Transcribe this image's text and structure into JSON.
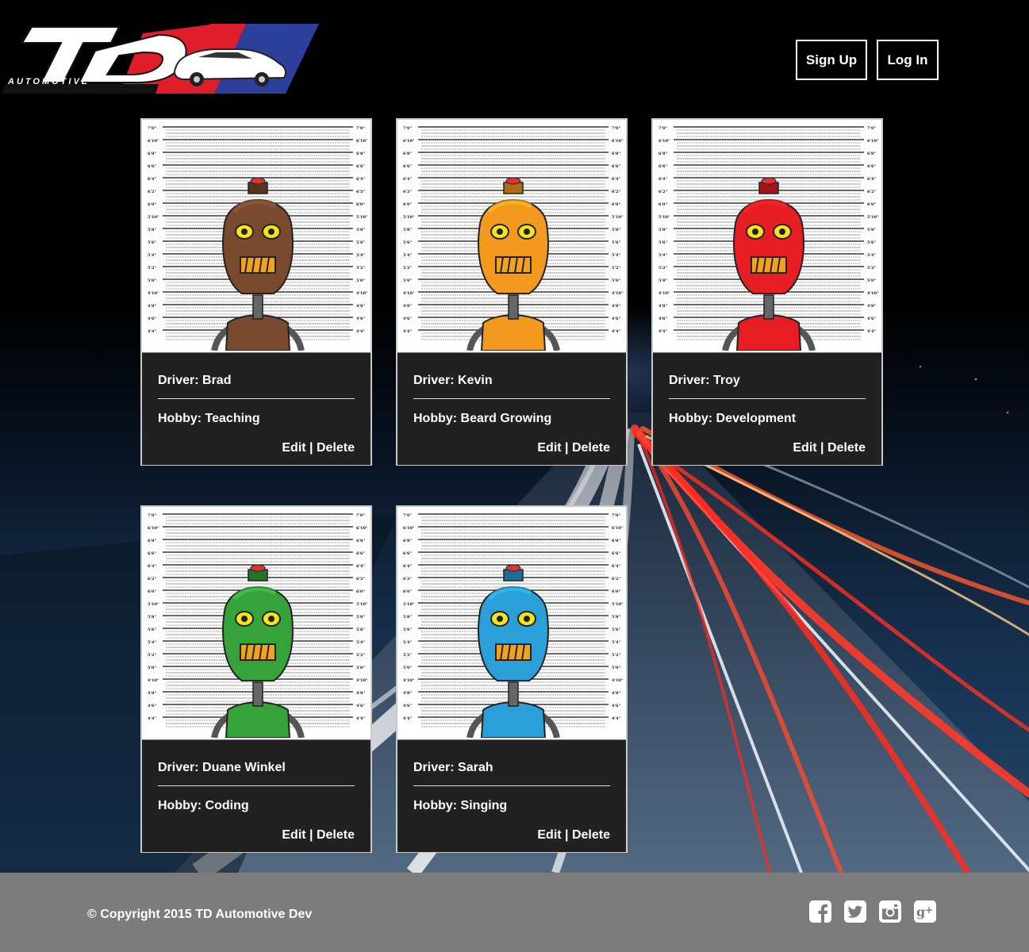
{
  "header": {
    "logo_text": "TD",
    "logo_subtext": "AUTOMOTIVE",
    "signup_label": "Sign Up",
    "login_label": "Log In"
  },
  "cards": [
    {
      "driver": "Driver: Brad",
      "hobby": "Hobby: Teaching",
      "edit": "Edit",
      "sep": " | ",
      "delete": "Delete",
      "robot_color": "#7a4a2e"
    },
    {
      "driver": "Driver: Kevin",
      "hobby": "Hobby: Beard Growing",
      "edit": "Edit",
      "sep": " | ",
      "delete": "Delete",
      "robot_color": "#f39a1e"
    },
    {
      "driver": "Driver: Troy",
      "hobby": "Hobby: Development",
      "edit": "Edit",
      "sep": " | ",
      "delete": "Delete",
      "robot_color": "#e61e24"
    },
    {
      "driver": "Driver: Duane Winkel",
      "hobby": "Hobby: Coding",
      "edit": "Edit",
      "sep": " | ",
      "delete": "Delete",
      "robot_color": "#35a33a"
    },
    {
      "driver": "Driver: Sarah",
      "hobby": "Hobby: Singing",
      "edit": "Edit",
      "sep": " | ",
      "delete": "Delete",
      "robot_color": "#2a9fd8"
    }
  ],
  "height_chart_labels": [
    "7'0\"",
    "6'10\"",
    "6'8\"",
    "6'6\"",
    "6'4\"",
    "6'2\"",
    "6'0\"",
    "5'10\"",
    "5'8\"",
    "5'6\"",
    "5'4\"",
    "5'2\"",
    "5'0\"",
    "4'10\"",
    "4'8\"",
    "4'6\"",
    "4'4\""
  ],
  "footer": {
    "copyright": "© Copyright 2015 TD Automotive Dev",
    "social_icons": [
      "facebook-icon",
      "twitter-icon",
      "instagram-icon",
      "google-plus-icon"
    ]
  }
}
